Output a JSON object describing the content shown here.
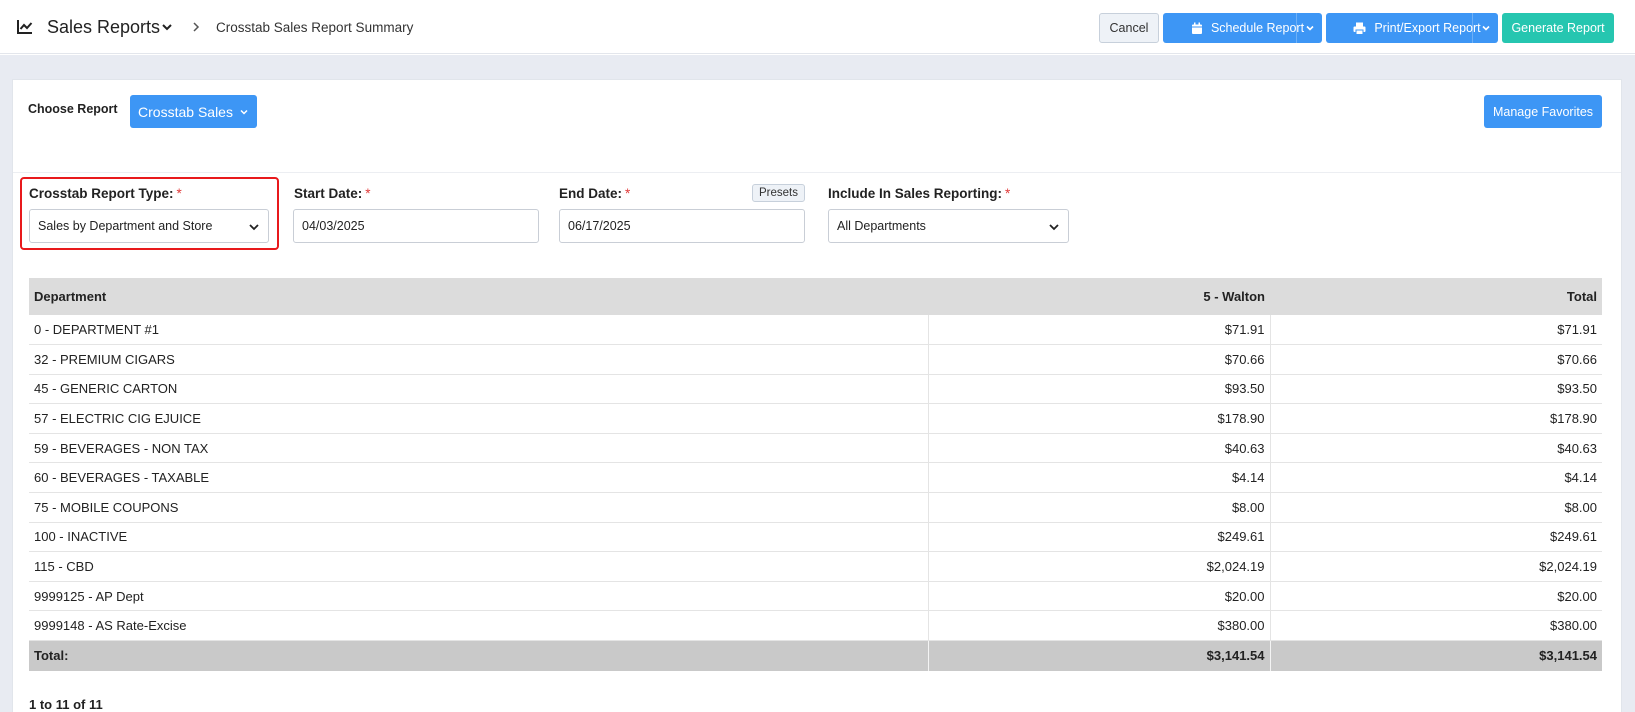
{
  "header": {
    "title": "Sales Reports",
    "breadcrumb": "Crosstab Sales Report Summary",
    "cancel_label": "Cancel",
    "schedule_label": "Schedule Report",
    "print_label": "Print/Export Report",
    "generate_label": "Generate Report"
  },
  "choose": {
    "label": "Choose Report",
    "report_button": "Crosstab Sales",
    "manage_label": "Manage Favorites"
  },
  "filters": {
    "report_type": {
      "label": "Crosstab Report Type:",
      "required": "*",
      "value": "Sales by Department and Store"
    },
    "start_date": {
      "label": "Start Date:",
      "required": "*",
      "value": "04/03/2025"
    },
    "end_date": {
      "label": "End Date:",
      "required": "*",
      "value": "06/17/2025",
      "presets_label": "Presets"
    },
    "include": {
      "label": "Include In Sales Reporting:",
      "required": "*",
      "value": "All Departments"
    }
  },
  "table": {
    "columns": [
      "Department",
      "5 - Walton",
      "Total"
    ],
    "rows": [
      [
        "0 - DEPARTMENT #1",
        "$71.91",
        "$71.91"
      ],
      [
        "32 - PREMIUM CIGARS",
        "$70.66",
        "$70.66"
      ],
      [
        "45 - GENERIC CARTON",
        "$93.50",
        "$93.50"
      ],
      [
        "57 - ELECTRIC CIG EJUICE",
        "$178.90",
        "$178.90"
      ],
      [
        "59 - BEVERAGES - NON TAX",
        "$40.63",
        "$40.63"
      ],
      [
        "60 - BEVERAGES - TAXABLE",
        "$4.14",
        "$4.14"
      ],
      [
        "75 - MOBILE COUPONS",
        "$8.00",
        "$8.00"
      ],
      [
        "100 - INACTIVE",
        "$249.61",
        "$249.61"
      ],
      [
        "115 - CBD",
        "$2,024.19",
        "$2,024.19"
      ],
      [
        "9999125 - AP Dept",
        "$20.00",
        "$20.00"
      ],
      [
        "9999148 - AS Rate-Excise",
        "$380.00",
        "$380.00"
      ]
    ],
    "total": [
      "Total:",
      "$3,141.54",
      "$3,141.54"
    ]
  },
  "pager": {
    "text": "1 to 11 of 11"
  },
  "colors": {
    "primary": "#3d96f5",
    "generate": "#26c6b0",
    "highlight": "#e8191c",
    "required": "#e03a3a"
  },
  "icons": [
    "line-chart-icon",
    "chevron-down-icon",
    "chevron-right-icon",
    "calendar-icon",
    "printer-icon"
  ]
}
